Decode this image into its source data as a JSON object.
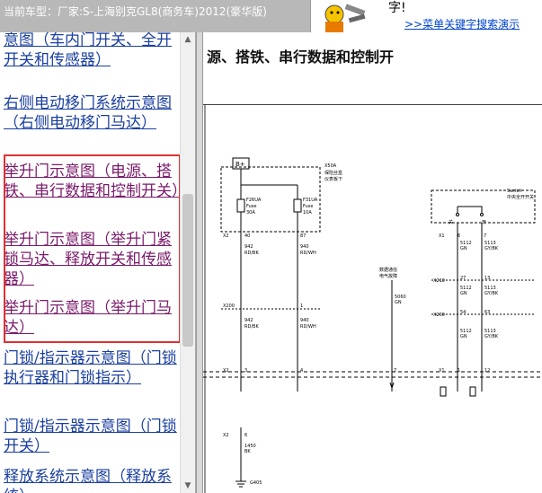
{
  "header": {
    "vehicle_text": "当前车型：厂家:S-上海别克GL8(商务车)2012(豪华版)",
    "ad_text": "字!",
    "ad_link": ">>菜单关键字搜索演示"
  },
  "sidebar": {
    "items": [
      {
        "label": "意图（车内门开关、全开开关和传感器）"
      },
      {
        "label": "右侧电动移门系统示意图（右侧电动移门马达）"
      },
      {
        "label": "举升门示意图（电源、搭铁、串行数据和控制开关）"
      },
      {
        "label": "举升门示意图（举升门紧锁马达、释放开关和传感器）"
      },
      {
        "label": "举升门示意图（举升门马达）"
      },
      {
        "label": "门锁/指示器示意图（门锁执行器和门锁指示）"
      },
      {
        "label": "门锁/指示器示意图（门锁开关）"
      },
      {
        "label": "释放系统示意图（释放系统）"
      }
    ]
  },
  "content": {
    "title": "源、搭铁、串行数据和控制开",
    "diagram": {
      "bplus": "B+",
      "x50a": "X50A",
      "x50a_sub1": "仪表板下",
      "x50a_sub2": "保险丝盒",
      "fuse1_name": "F26UA",
      "fuse1_type": "Fuse",
      "fuse1_rating": "30A",
      "fuse2_name": "F31UA",
      "fuse2_type": "Fuse",
      "fuse2_rating": "10A",
      "x2": "X2",
      "pin40": "40",
      "pin87": "87",
      "w1": "942",
      "w1c": "RD/BK",
      "w2": "940",
      "w2c": "RD/WH",
      "x200": "X200",
      "pin1": "1",
      "pin3": "3",
      "pin4": "4",
      "sw_label1": "Switch",
      "sw_label2": "Switch",
      "sw_sub": "中央全开开关",
      "x1": "X1",
      "p6": "6",
      "p7": "7",
      "w3": "5112",
      "w3c": "GN",
      "w4": "5113",
      "w4c": "GY/BK",
      "x210": "X210",
      "p27": "27",
      "p13": "13",
      "x200b": "X200",
      "p54": "54",
      "p63": "63",
      "serial_label1": "数据通信",
      "serial_label2": "电气故障",
      "w5": "5060",
      "w5c": "GN",
      "p7b": "7",
      "p12": "12",
      "ground_wire": "1450",
      "ground_color": "BK",
      "g405": "G405",
      "x2b": "X2",
      "p6b": "6",
      "open_label": "关",
      "close_label": "开"
    }
  }
}
